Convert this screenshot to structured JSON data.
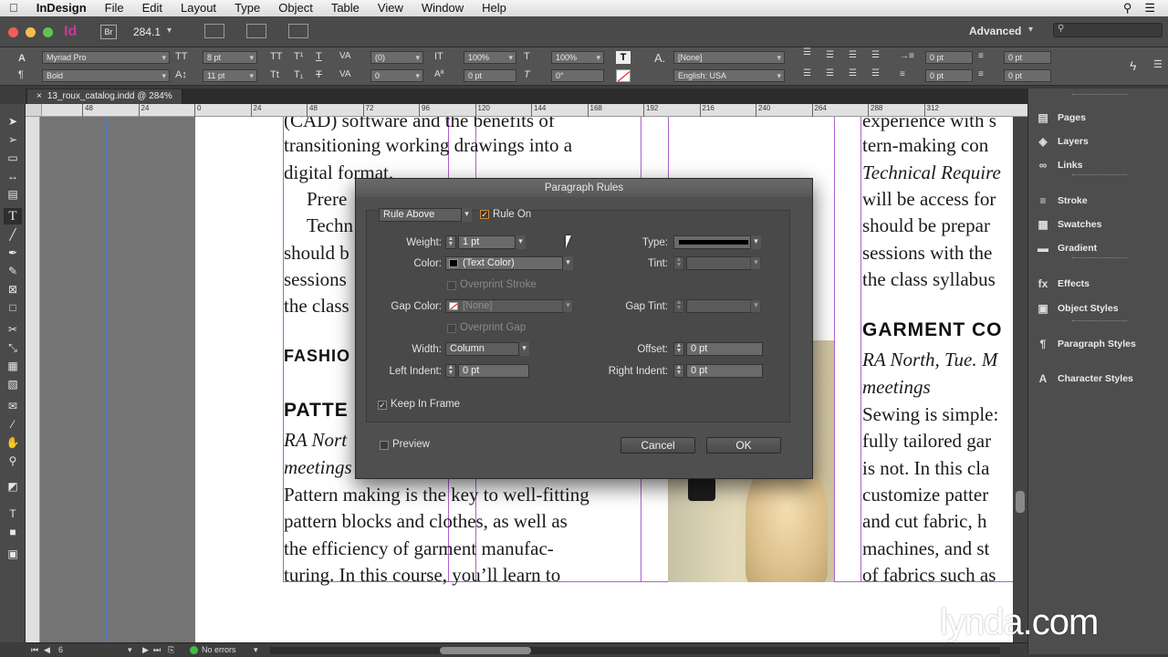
{
  "menubar": {
    "apple": "",
    "app": "InDesign",
    "items": [
      "File",
      "Edit",
      "Layout",
      "Type",
      "Object",
      "Table",
      "View",
      "Window",
      "Help"
    ]
  },
  "appbar": {
    "bridge": "Br",
    "zoom": "284.1",
    "workspace": "Advanced",
    "search_placeholder": ""
  },
  "control": {
    "font_family": "Myriad Pro",
    "font_style": "Bold",
    "font_size": "8 pt",
    "leading": "11 pt",
    "kerning": "(0)",
    "tracking": "0",
    "vscale": "100%",
    "hscale": "100%",
    "baseline": "0 pt",
    "skew": "0°",
    "char_style": "[None]",
    "language": "English: USA",
    "indent_l1": "0 pt",
    "indent_l2": "0 pt",
    "indent_r1": "0 pt",
    "indent_r2": "0 pt"
  },
  "document": {
    "tab_title": "13_roux_catalog.indd @ 284%"
  },
  "ruler": {
    "h_ticks": [
      "48",
      "24",
      "0",
      "24",
      "48",
      "72",
      "96",
      "120",
      "144",
      "168",
      "192",
      "216",
      "240",
      "264",
      "288",
      "312"
    ]
  },
  "page": {
    "col1": [
      {
        "text": "(CAD) software and the benefits of",
        "style": "body"
      },
      {
        "text": "transitioning working drawings into a",
        "style": "body"
      },
      {
        "text": "digital format.",
        "style": "body"
      },
      {
        "text": "Prere",
        "style": "body-indent"
      },
      {
        "text": "Techn",
        "style": "body-indent"
      },
      {
        "text": "should b",
        "style": "body"
      },
      {
        "text": "sessions",
        "style": "body"
      },
      {
        "text": "the class",
        "style": "body"
      },
      {
        "text": "FASHIO",
        "style": "head-small"
      },
      {
        "text": "PATTE",
        "style": "head"
      },
      {
        "text": "RA Nort",
        "style": "italic"
      },
      {
        "text": "meetings",
        "style": "italic"
      },
      {
        "text": "Pattern making is the key to well-fitting",
        "style": "body"
      },
      {
        "text": "pattern blocks and clothes, as well as",
        "style": "body"
      },
      {
        "text": "the efficiency of garment manufac-",
        "style": "body"
      },
      {
        "text": "turing. In this course, you’ll learn to",
        "style": "body"
      }
    ],
    "col3": [
      {
        "text": "experience with s",
        "style": "body"
      },
      {
        "text": "tern-making con",
        "style": "body"
      },
      {
        "text": "Technical Require",
        "style": "italic"
      },
      {
        "text": "will be access for",
        "style": "body"
      },
      {
        "text": "should be prepar",
        "style": "body"
      },
      {
        "text": "sessions with the",
        "style": "body"
      },
      {
        "text": "the class syllabus",
        "style": "body"
      },
      {
        "text": "GARMENT CO",
        "style": "head"
      },
      {
        "text": "RA North, Tue. M",
        "style": "italic"
      },
      {
        "text": "meetings",
        "style": "italic"
      },
      {
        "text": "Sewing is simple:",
        "style": "body"
      },
      {
        "text": "fully tailored gar",
        "style": "body"
      },
      {
        "text": "is not. In this cla",
        "style": "body"
      },
      {
        "text": "customize patter",
        "style": "body"
      },
      {
        "text": "and cut fabric, h",
        "style": "body"
      },
      {
        "text": "machines, and st",
        "style": "body"
      },
      {
        "text": "of fabrics such as",
        "style": "body"
      }
    ]
  },
  "panels": [
    {
      "label": "Pages",
      "icon": "pages-icon"
    },
    {
      "label": "Layers",
      "icon": "layers-icon"
    },
    {
      "label": "Links",
      "icon": "links-icon"
    },
    {
      "label": "Stroke",
      "icon": "stroke-icon"
    },
    {
      "label": "Swatches",
      "icon": "swatches-icon"
    },
    {
      "label": "Gradient",
      "icon": "gradient-icon"
    },
    {
      "label": "Effects",
      "icon": "fx-icon"
    },
    {
      "label": "Object Styles",
      "icon": "object-styles-icon"
    },
    {
      "label": "Paragraph Styles",
      "icon": "paragraph-styles-icon"
    },
    {
      "label": "Character Styles",
      "icon": "character-styles-icon"
    }
  ],
  "dialog": {
    "title": "Paragraph Rules",
    "rule_select": "Rule Above",
    "rule_on_label": "Rule On",
    "rule_on": true,
    "weight_label": "Weight:",
    "weight": "1 pt",
    "type_label": "Type:",
    "color_label": "Color:",
    "color": "(Text Color)",
    "tint_label": "Tint:",
    "overprint_stroke": "Overprint Stroke",
    "gap_color_label": "Gap Color:",
    "gap_color": "[None]",
    "gap_tint_label": "Gap Tint:",
    "overprint_gap": "Overprint Gap",
    "width_label": "Width:",
    "width": "Column",
    "offset_label": "Offset:",
    "offset": "0 pt",
    "left_indent_label": "Left Indent:",
    "left_indent": "0 pt",
    "right_indent_label": "Right Indent:",
    "right_indent": "0 pt",
    "keep_in_frame": "Keep In Frame",
    "keep_in_frame_checked": true,
    "preview": "Preview",
    "preview_checked": false,
    "cancel": "Cancel",
    "ok": "OK"
  },
  "status": {
    "page": "6",
    "errors": "No errors",
    "error_color": "#3fbf3f"
  },
  "watermark": "lynda.com"
}
